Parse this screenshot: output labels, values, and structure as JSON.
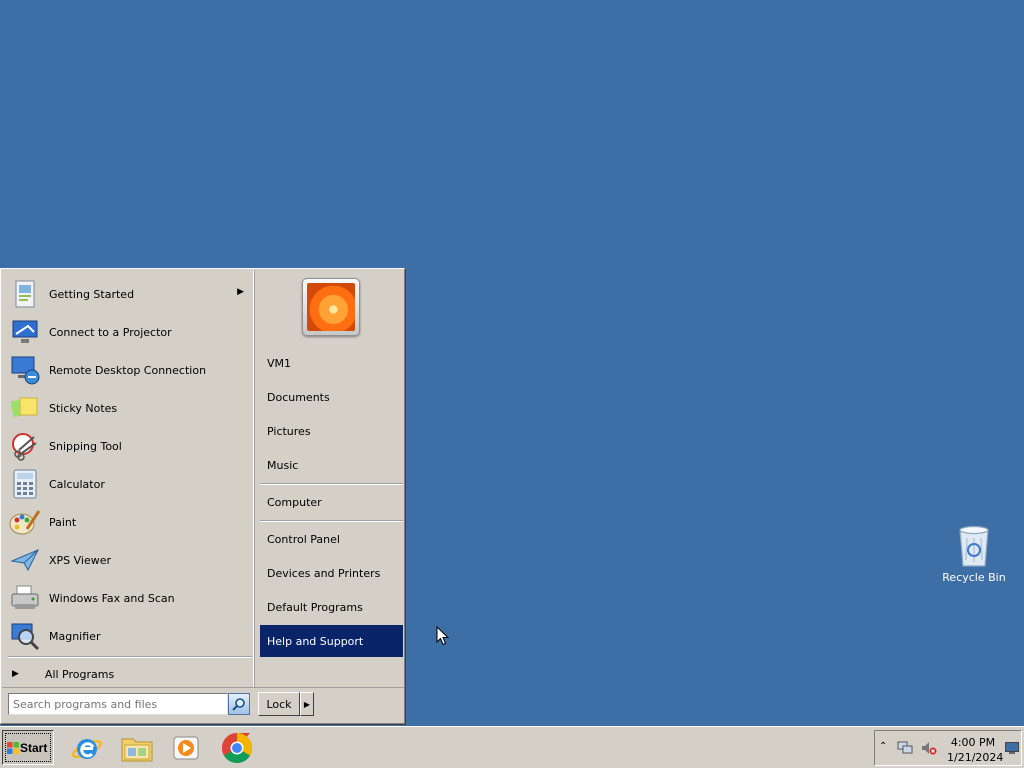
{
  "desktop": {
    "background_color": "#3d6ea5",
    "icons": [
      {
        "label": "Recycle Bin",
        "icon": "recycle-bin-icon"
      }
    ]
  },
  "start_menu": {
    "programs": [
      {
        "label": "Getting Started",
        "icon": "getting-started-icon",
        "has_submenu": true
      },
      {
        "label": "Connect to a Projector",
        "icon": "projector-icon",
        "has_submenu": false
      },
      {
        "label": "Remote Desktop Connection",
        "icon": "remote-desktop-icon",
        "has_submenu": false
      },
      {
        "label": "Sticky Notes",
        "icon": "sticky-notes-icon",
        "has_submenu": false
      },
      {
        "label": "Snipping Tool",
        "icon": "snipping-tool-icon",
        "has_submenu": false
      },
      {
        "label": "Calculator",
        "icon": "calculator-icon",
        "has_submenu": false
      },
      {
        "label": "Paint",
        "icon": "paint-icon",
        "has_submenu": false
      },
      {
        "label": "XPS Viewer",
        "icon": "xps-viewer-icon",
        "has_submenu": false
      },
      {
        "label": "Windows Fax and Scan",
        "icon": "fax-scan-icon",
        "has_submenu": false
      },
      {
        "label": "Magnifier",
        "icon": "magnifier-icon",
        "has_submenu": false
      }
    ],
    "all_programs_label": "All Programs",
    "search_placeholder": "Search programs and files",
    "right_items": [
      {
        "label": "VM1"
      },
      {
        "label": "Documents"
      },
      {
        "label": "Pictures"
      },
      {
        "label": "Music"
      },
      {
        "label": "Computer"
      },
      {
        "label": "Control Panel"
      },
      {
        "label": "Devices and Printers"
      },
      {
        "label": "Default Programs"
      },
      {
        "label": "Help and Support",
        "highlighted": true
      }
    ],
    "highlight_color": "#0a246a",
    "lock_label": "Lock"
  },
  "taskbar": {
    "start_label": "Start",
    "pinned": [
      {
        "name": "Internet Explorer",
        "icon": "internet-explorer-icon"
      },
      {
        "name": "Windows Explorer",
        "icon": "folder-icon"
      },
      {
        "name": "Windows Media Player",
        "icon": "media-player-icon"
      },
      {
        "name": "Google Chrome",
        "icon": "chrome-icon"
      }
    ],
    "clock": {
      "time": "4:00 PM",
      "date": "1/21/2024"
    }
  }
}
